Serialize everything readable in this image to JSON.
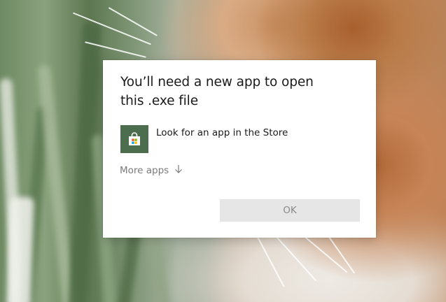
{
  "dialog": {
    "title": "You’ll need a new app to open this .exe file",
    "store_option": {
      "label": "Look for an app in the Store",
      "icon": "store-bag-icon",
      "tile_color": "#4d6d4f"
    },
    "more_apps": {
      "label": "More apps",
      "icon": "arrow-down-icon"
    },
    "ok_button": {
      "label": "OK"
    }
  },
  "colors": {
    "dialog_background": "#ffffff",
    "button_background": "#e6e6e6",
    "button_text": "#8a8a8a",
    "secondary_text": "#7a7a7a"
  }
}
